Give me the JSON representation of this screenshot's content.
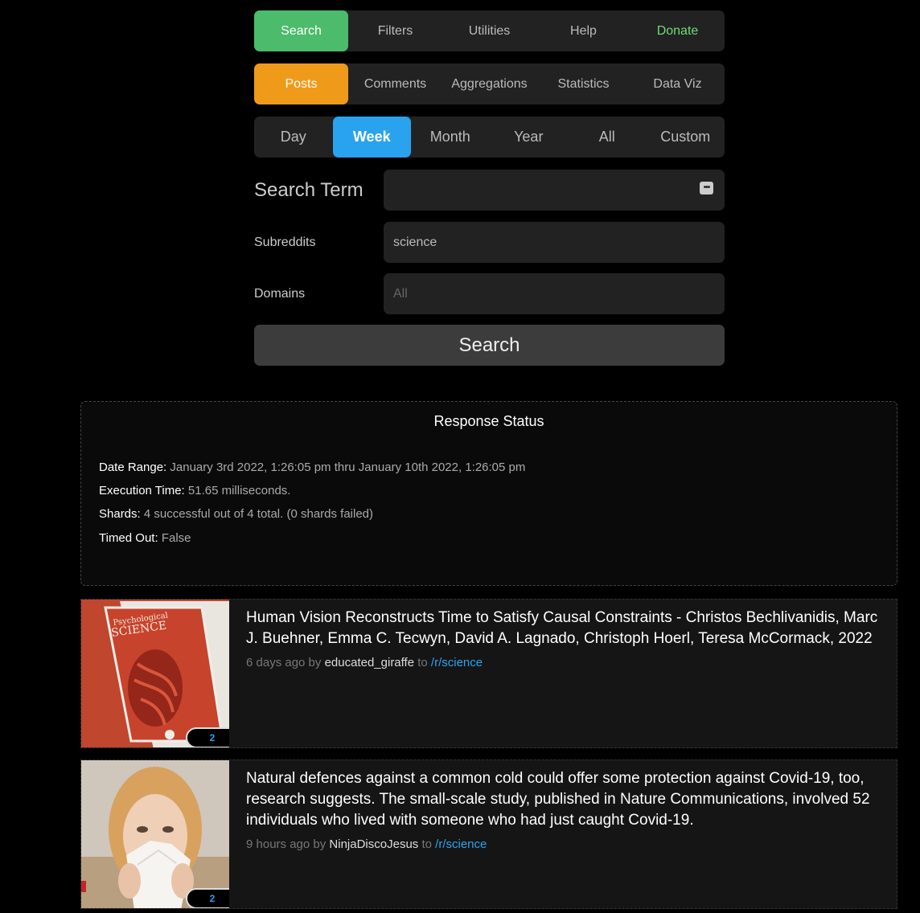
{
  "nav": {
    "tabs": [
      {
        "label": "Search"
      },
      {
        "label": "Filters"
      },
      {
        "label": "Utilities"
      },
      {
        "label": "Help"
      },
      {
        "label": "Donate"
      }
    ]
  },
  "types": {
    "tabs": [
      {
        "label": "Posts"
      },
      {
        "label": "Comments"
      },
      {
        "label": "Aggregations"
      },
      {
        "label": "Statistics"
      },
      {
        "label": "Data Viz"
      }
    ]
  },
  "ranges": {
    "tabs": [
      {
        "label": "Day"
      },
      {
        "label": "Week"
      },
      {
        "label": "Month"
      },
      {
        "label": "Year"
      },
      {
        "label": "All"
      },
      {
        "label": "Custom"
      }
    ]
  },
  "form": {
    "search_term_label": "Search Term",
    "search_term_value": "",
    "subreddits_label": "Subreddits",
    "subreddits_value": "science",
    "domains_label": "Domains",
    "domains_placeholder": "All",
    "search_button": "Search"
  },
  "status": {
    "title": "Response Status",
    "date_range_label": "Date Range:",
    "date_range_value": "January 3rd 2022, 1:26:05 pm thru January 10th 2022, 1:26:05 pm",
    "execution_label": "Execution Time:",
    "execution_value": "51.65 milliseconds.",
    "shards_label": "Shards:",
    "shards_value": "4 successful out of 4 total. (0 shards failed)",
    "timed_out_label": "Timed Out:",
    "timed_out_value": "False"
  },
  "posts": [
    {
      "title": "Human Vision Reconstructs Time to Satisfy Causal Constraints - Christos Bechlivanidis, Marc J. Buehner, Emma C. Tecwyn, David A. Lagnado, Christoph Hoerl, Teresa McCormack, 2022",
      "age": "6 days ago by",
      "author": "educated_giraffe",
      "to": "to",
      "subreddit": "/r/science",
      "comments": "2",
      "thumb_text": "Psychological SCIENCE"
    },
    {
      "title": "Natural defences against a common cold could offer some protection against Covid-19, too, research suggests. The small-scale study, published in Nature Communications, involved 52 individuals who lived with someone who had just caught Covid-19.",
      "age": "9 hours ago by",
      "author": "NinjaDiscoJesus",
      "to": "to",
      "subreddit": "/r/science",
      "comments": "2"
    }
  ]
}
